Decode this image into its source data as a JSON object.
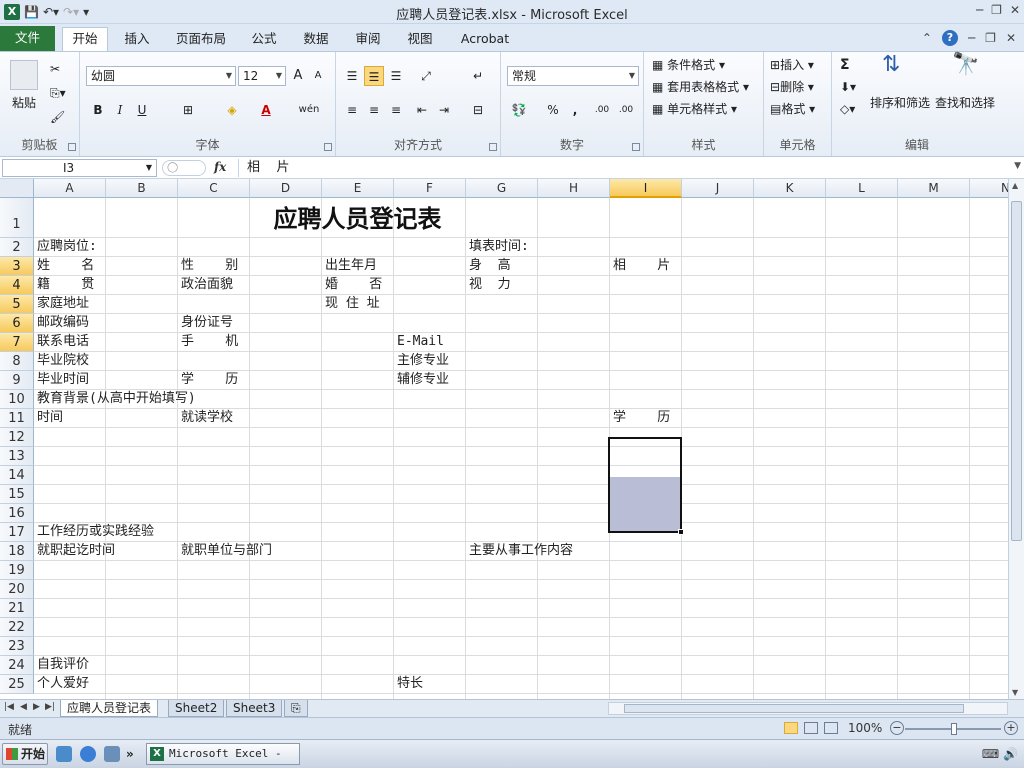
{
  "window": {
    "title": "应聘人员登记表.xlsx - Microsoft Excel",
    "qat": {
      "save_icon": "save-icon",
      "undo_icon": "undo-icon",
      "redo_icon": "redo-icon"
    },
    "controls": [
      "─",
      "❐",
      "✕"
    ]
  },
  "tabs": [
    "文件",
    "开始",
    "插入",
    "页面布局",
    "公式",
    "数据",
    "审阅",
    "视图",
    "Acrobat"
  ],
  "ribbon": {
    "clipboard": {
      "paste": "粘贴",
      "label": "剪贴板"
    },
    "font": {
      "name": "幼圆",
      "size": "12",
      "label": "字体",
      "grow": "A",
      "shrink": "A",
      "bold": "B",
      "italic": "I",
      "underline": "U",
      "color_a": "A",
      "wen": "wén"
    },
    "alignment": {
      "label": "对齐方式"
    },
    "number": {
      "format": "常规",
      "percent": "%",
      "comma": ",",
      "inc": ".00",
      "dec": ".00",
      "label": "数字"
    },
    "styles": {
      "cond": "条件格式",
      "table": "套用表格格式",
      "cell": "单元格样式",
      "label": "样式"
    },
    "cells": {
      "insert": "插入",
      "delete": "删除",
      "format": "格式",
      "label": "单元格"
    },
    "editing": {
      "sum": "Σ",
      "sort": "排序和筛选",
      "find": "查找和选择",
      "label": "编辑"
    }
  },
  "formula_bar": {
    "name_box": "I3",
    "fx": "fx",
    "content": "相    片"
  },
  "columns": [
    "A",
    "B",
    "C",
    "D",
    "E",
    "F",
    "G",
    "H",
    "I",
    "J",
    "K",
    "L",
    "M",
    "N"
  ],
  "selected_column": "I",
  "rows": [
    "1",
    "2",
    "3",
    "4",
    "5",
    "6",
    "7",
    "8",
    "9",
    "10",
    "11",
    "12",
    "13",
    "14",
    "15",
    "16",
    "17",
    "18",
    "19",
    "20",
    "21",
    "22",
    "23",
    "24",
    "25"
  ],
  "selected_rows": [
    "3",
    "4",
    "5",
    "6",
    "7"
  ],
  "sheet": {
    "title": "应聘人员登记表",
    "cells": {
      "a2": "应聘岗位:",
      "g2": "填表时间:",
      "a3": "姓    名",
      "c3": "性    别",
      "e3": "出生年月",
      "g3": "身  高",
      "i3": "相    片",
      "a4": "籍    贯",
      "c4": "政治面貌",
      "e4": "婚    否",
      "g4": "视  力",
      "a5": "家庭地址",
      "e5": "现 住 址",
      "a6": "邮政编码",
      "c6": "身份证号",
      "a7": "联系电话",
      "c7": "手    机",
      "f7": "E-Mail",
      "a8": "毕业院校",
      "f8": "主修专业",
      "a9": "毕业时间",
      "c9": "学    历",
      "f9": "辅修专业",
      "a10": "教育背景(从高中开始填写)",
      "a11": "时间",
      "c11": "就读学校",
      "i11": "学    历",
      "a17": "工作经历或实践经验",
      "a18": "就职起讫时间",
      "c18": "就职单位与部门",
      "g18": "主要从事工作内容",
      "a24": "自我评价",
      "a25": "个人爱好",
      "f25": "特长"
    }
  },
  "sheet_tabs": [
    "应聘人员登记表",
    "Sheet2",
    "Sheet3"
  ],
  "status": {
    "ready": "就绪",
    "zoom": "100%"
  },
  "taskbar": {
    "start": "开始",
    "task": "Microsoft Excel - ...",
    "chevron": "»"
  }
}
